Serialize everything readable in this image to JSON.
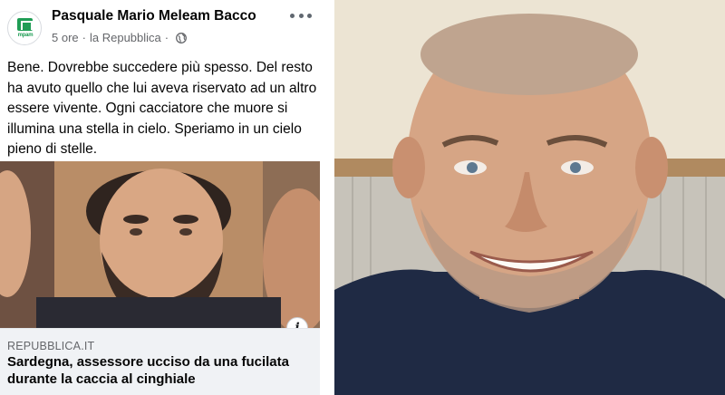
{
  "post": {
    "author": "Pasquale Mario Meleam Bacco",
    "avatar_logo_text": "mpam",
    "time": "5 ore",
    "source": "la Repubblica",
    "audience_icon": "globe-icon",
    "more_icon": "more-options-icon",
    "text": "Bene. Dovrebbe succedere più spesso. Del resto ha avuto quello che lui aveva riservato ad un altro essere vivente. Ogni cacciatore che muore si illumina una stella in cielo. Speriamo in un cielo pieno di stelle.",
    "link": {
      "domain": "REPUBBLICA.IT",
      "title": "Sardegna, assessore ucciso da una fucilata durante la caccia al cinghiale",
      "info_icon": "info-icon"
    }
  },
  "colors": {
    "text_primary": "#050505",
    "text_secondary": "#65676b",
    "link_card_bg": "#f0f2f5",
    "logo_green": "#1f9d55"
  }
}
